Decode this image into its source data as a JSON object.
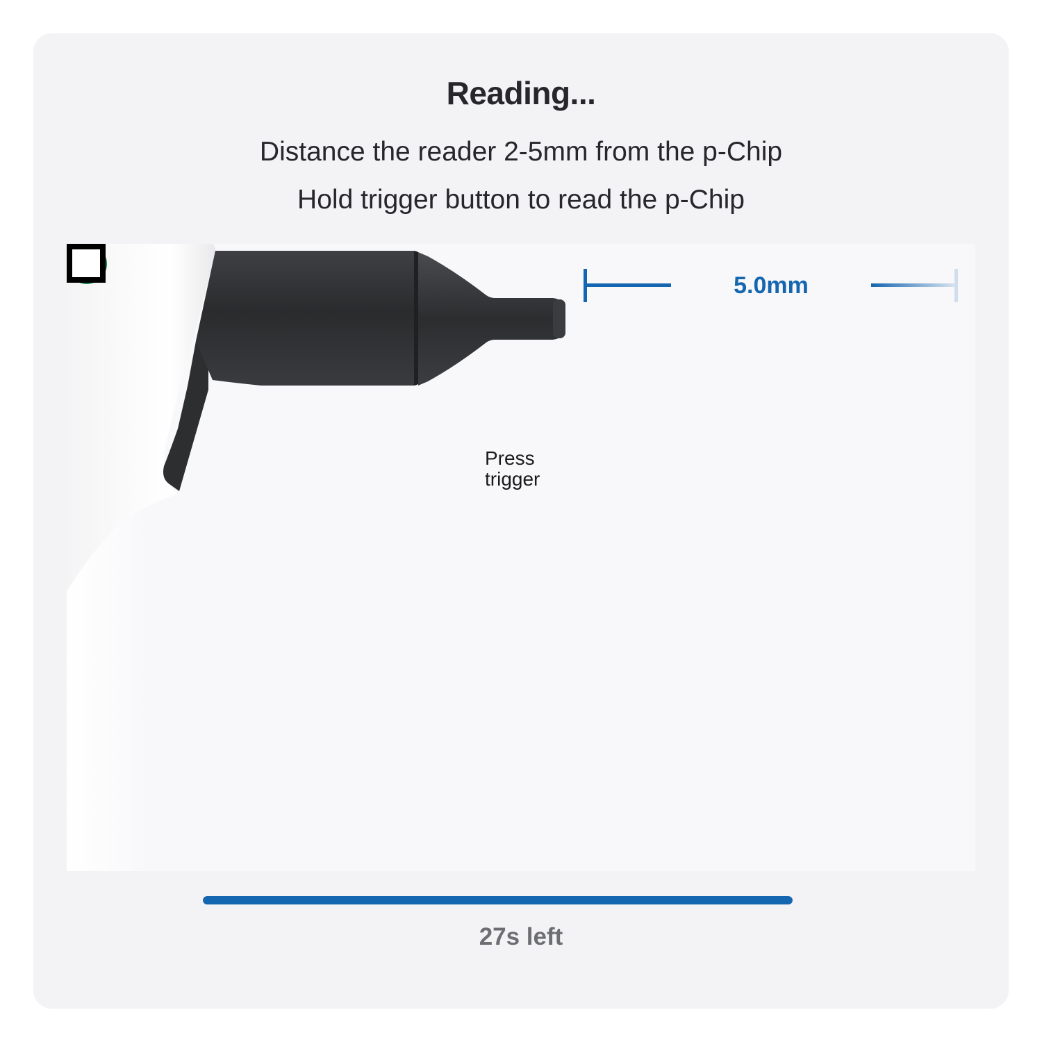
{
  "dialog": {
    "title": "Reading...",
    "instructions": [
      "Distance the reader 2-5mm from the p-Chip",
      "Hold trigger button to read the p-Chip"
    ]
  },
  "distance": {
    "label": "5.0mm",
    "status_icon": "check-circle-icon",
    "status_color": "#15854a",
    "accent_color": "#1566b0"
  },
  "trigger_hint": {
    "icon": "square-outline-icon",
    "label_line1": "Press",
    "label_line2": "trigger"
  },
  "progress": {
    "fraction": 1.0,
    "time_left": "27s left",
    "color": "#1566b0"
  }
}
